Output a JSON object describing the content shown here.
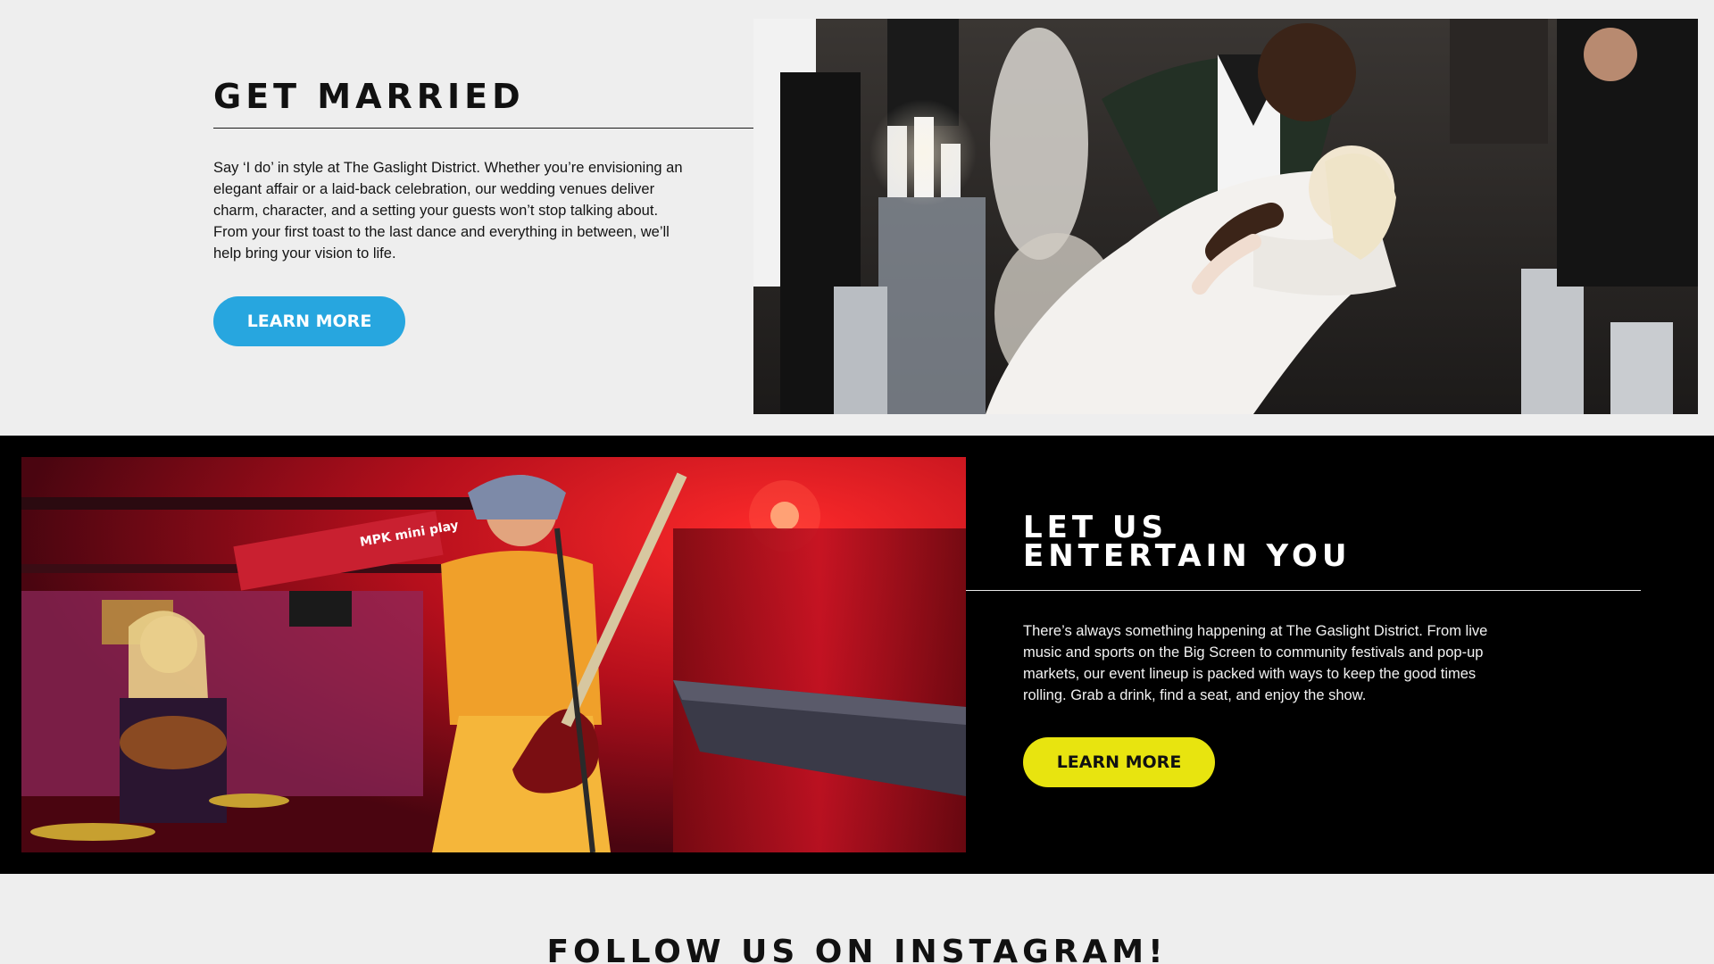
{
  "married": {
    "title": "GET MARRIED",
    "body": "Say ‘I do’ in style at The Gaslight District. Whether you’re envisioning an elegant affair or a laid-back celebration, our wedding venues deliver charm, character, and a setting your guests won’t stop talking about. From your first toast to the last dance and everything in between, we’ll help bring your vision to life.",
    "button_label": "LEARN MORE",
    "button_color": "#27a6df"
  },
  "entertain": {
    "title_line1": "LET US",
    "title_line2": "ENTERTAIN YOU",
    "body": "There’s always something happening at The Gaslight District. From live music and sports on the Big Screen to community festivals and pop-up markets, our event lineup is packed with ways to keep the good times rolling. Grab a drink, find a seat, and enjoy the show.",
    "button_label": "LEARN MORE",
    "button_color": "#e8e40f",
    "keyboard_brand": "MPK mini play"
  },
  "instagram": {
    "title": "FOLLOW US ON INSTAGRAM!"
  }
}
